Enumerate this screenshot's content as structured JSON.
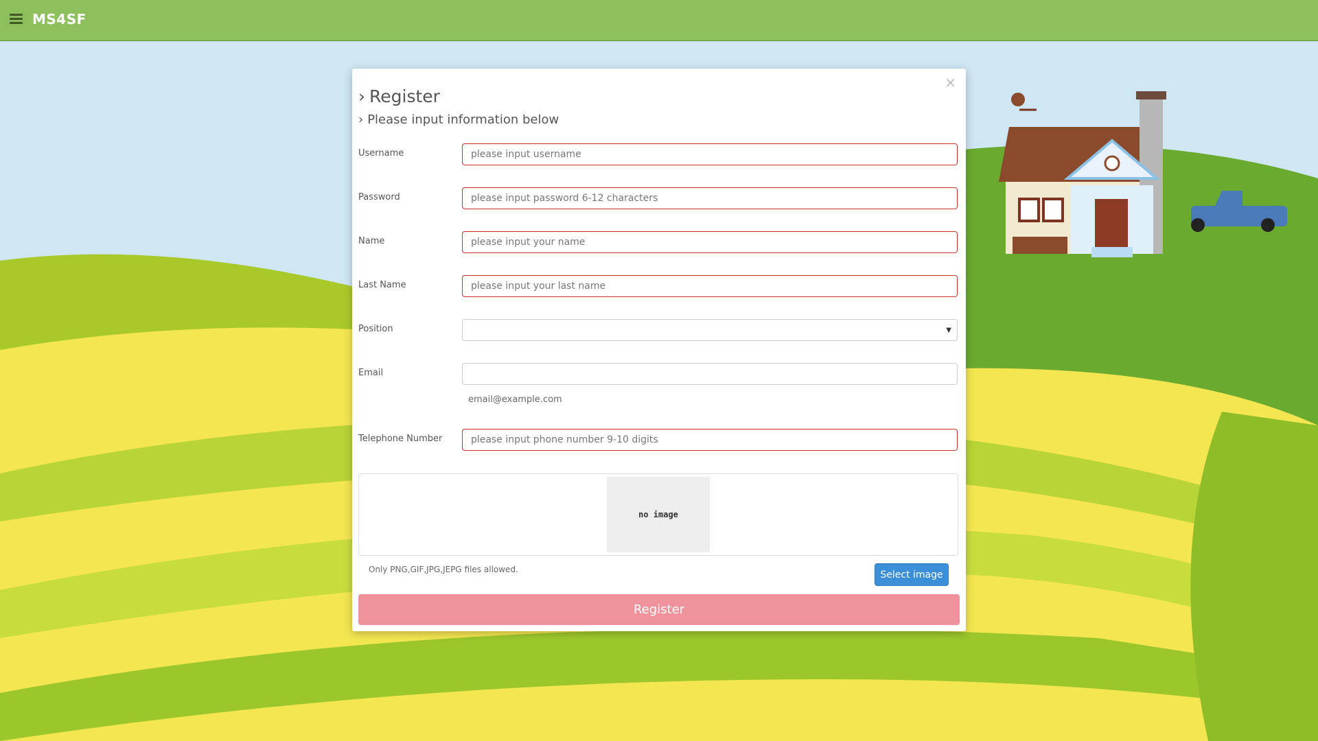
{
  "app": {
    "brand": "MS4SF"
  },
  "modal": {
    "title": "Register",
    "subtitle": "Please input information below",
    "close": "×"
  },
  "form": {
    "username": {
      "label": "Username",
      "placeholder": "please input username"
    },
    "password": {
      "label": "Password",
      "placeholder": "please input password 6-12 characters"
    },
    "name": {
      "label": "Name",
      "placeholder": "please input your name"
    },
    "last_name": {
      "label": "Last Name",
      "placeholder": "please input your last name"
    },
    "position": {
      "label": "Position",
      "value": ""
    },
    "email": {
      "label": "Email",
      "value": "",
      "help": "email@example.com"
    },
    "telephone": {
      "label": "Telephone Number",
      "placeholder": "please input phone number 9-10 digits"
    }
  },
  "upload": {
    "preview_text": "no image",
    "allowed_text": "Only PNG,GIF,JPG,JEPG files allowed.",
    "select_label": "Select image"
  },
  "submit": {
    "label": "Register"
  },
  "colors": {
    "topbar": "#8dc05c",
    "error_border": "#c9302c",
    "primary_button": "#3b8fd9",
    "register_button": "#f0929b"
  },
  "icons": {
    "menu": "hamburger-icon",
    "close": "close-icon",
    "chevron": "chevron-right-icon",
    "caret": "caret-down-icon"
  }
}
